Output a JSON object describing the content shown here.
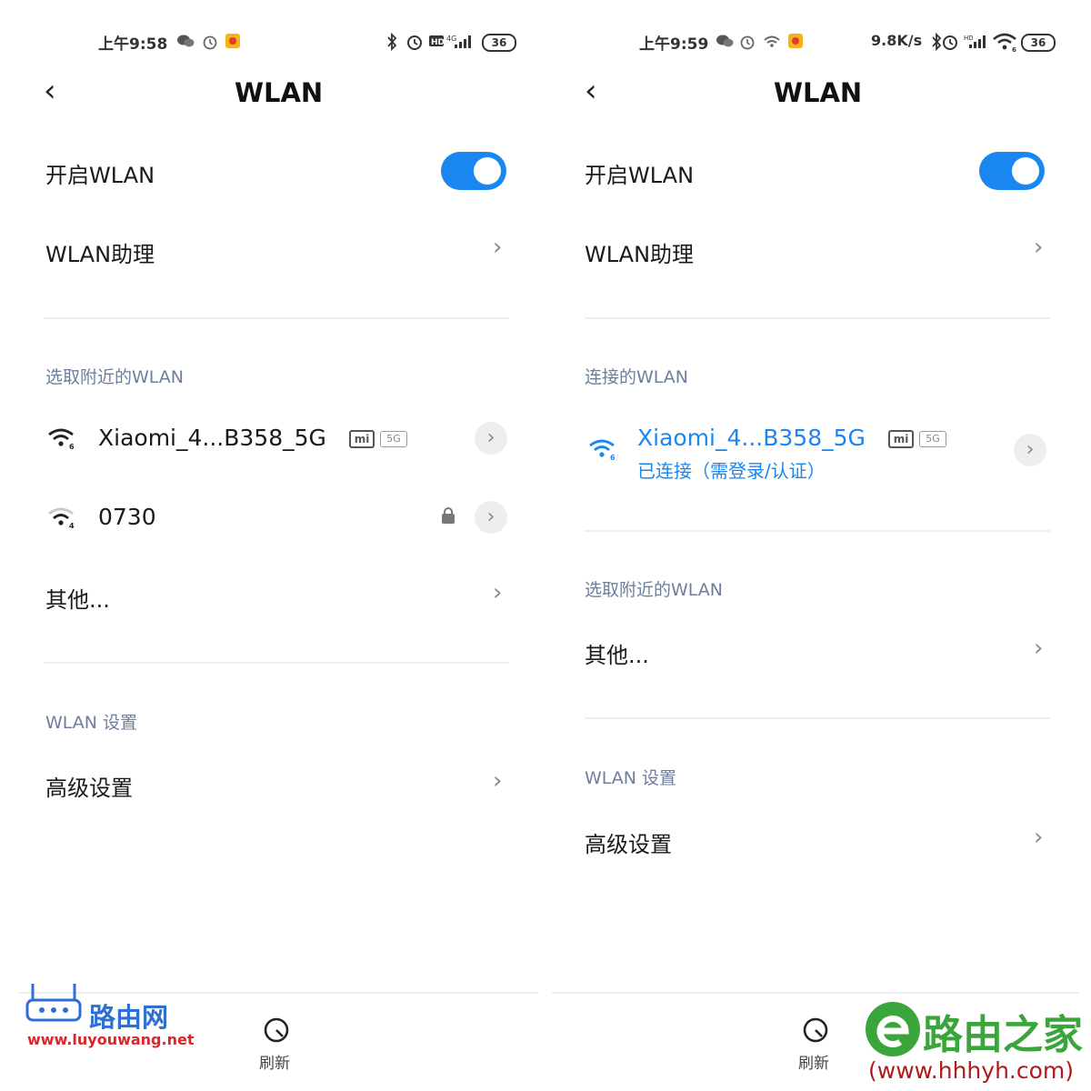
{
  "left": {
    "status": {
      "time": "上午9:58"
    },
    "title": "WLAN",
    "enable_label": "开启WLAN",
    "assistant_label": "WLAN助理",
    "nearby_header": "选取附近的WLAN",
    "networks": [
      {
        "ssid": "Xiaomi_4...B358_5G",
        "band": "5G",
        "vendor_badge": "mi",
        "locked": false
      },
      {
        "ssid": "0730",
        "locked": true
      }
    ],
    "other_label": "其他...",
    "settings_header": "WLAN 设置",
    "advanced_label": "高级设置",
    "refresh_label": "刷新"
  },
  "right": {
    "status": {
      "time": "上午9:59",
      "speed": "9.8K/s"
    },
    "title": "WLAN",
    "enable_label": "开启WLAN",
    "assistant_label": "WLAN助理",
    "connected_header": "连接的WLAN",
    "connected": {
      "ssid": "Xiaomi_4...B358_5G",
      "status": "已连接（需登录/认证）",
      "band": "5G",
      "vendor_badge": "mi"
    },
    "nearby_header": "选取附近的WLAN",
    "other_label": "其他...",
    "settings_header": "WLAN 设置",
    "advanced_label": "高级设置",
    "refresh_label": "刷新"
  },
  "status_battery": "36",
  "watermark_left": {
    "name": "路由网",
    "url": "www.luyouwang.net"
  },
  "watermark_right": {
    "name": "路由之家",
    "url": "(www.hhhyh.com)"
  },
  "colors": {
    "accent": "#1a86ef",
    "section": "#6d7f9c",
    "divider": "#eeeeee"
  }
}
